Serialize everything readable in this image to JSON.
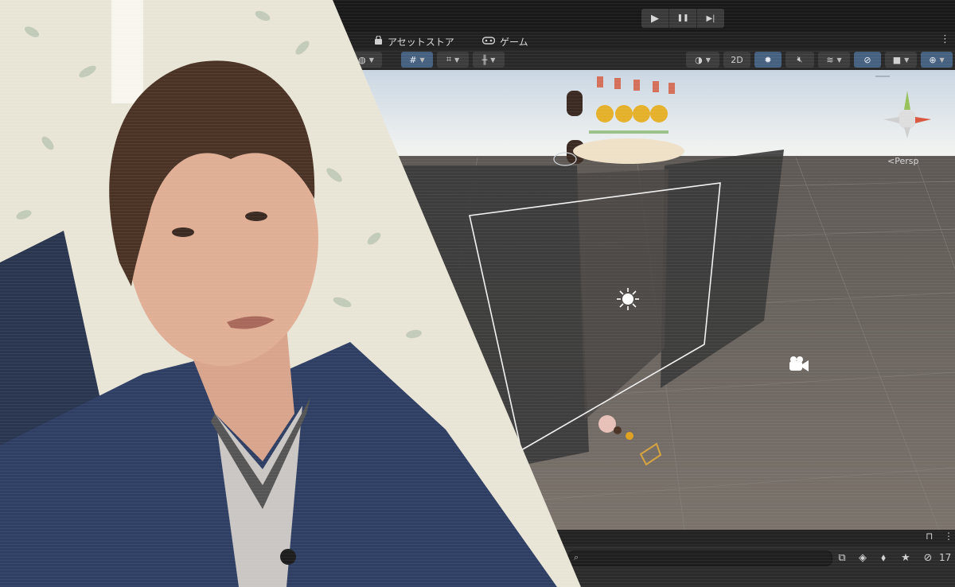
{
  "playbar": {
    "play": "▶",
    "pause": "❚❚",
    "step": "▶|"
  },
  "tabs": [
    {
      "label": "アセットストア",
      "icon": "bag-icon"
    },
    {
      "label": "ゲーム",
      "icon": "gamepad-icon"
    }
  ],
  "scene_toolbar": {
    "two_d_label": "2D"
  },
  "scene": {
    "persp_label": "<Persp"
  },
  "hierarchy": {
    "search_placeholder": "",
    "visible_count": "17"
  },
  "colors": {
    "sky_top": "#cfdbe6",
    "sky_bottom": "#f3f5f4",
    "ground": "#6f6964",
    "panel_dark": "#3f3f3f",
    "active_button": "#46607f",
    "jacket": "#2f3f63",
    "hair": "#4a3325",
    "curtain": "#e9e5d6"
  }
}
